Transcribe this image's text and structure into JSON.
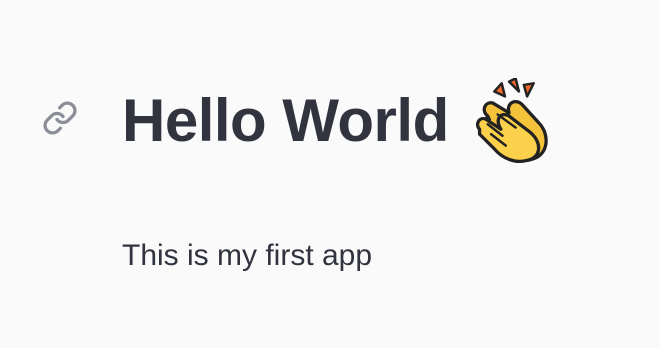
{
  "header": {
    "title": "Hello World",
    "title_emoji": "clapping-hands"
  },
  "main": {
    "paragraph": "This is my first app"
  },
  "icons": {
    "anchor": "link-icon"
  },
  "colors": {
    "text": "#31333f",
    "link_icon": "#8b8e97",
    "background": "#fafafa"
  }
}
